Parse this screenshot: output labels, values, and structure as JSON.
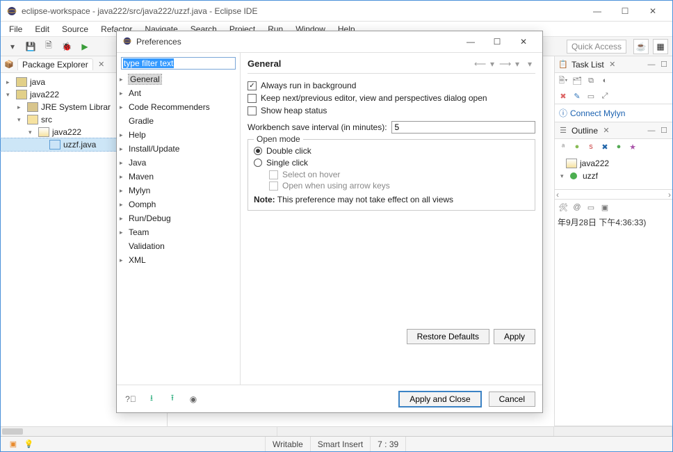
{
  "window": {
    "title": "eclipse-workspace - java222/src/java222/uzzf.java - Eclipse IDE"
  },
  "menu": [
    "File",
    "Edit",
    "Source",
    "Refactor",
    "Navigate",
    "Search",
    "Project",
    "Run",
    "Window",
    "Help"
  ],
  "quick_access": "Quick Access",
  "package_explorer": {
    "title": "Package Explorer",
    "items": {
      "java": "java",
      "java222": "java222",
      "jre": "JRE System Librar",
      "src": "src",
      "pkg": "java222",
      "file": "uzzf.java"
    }
  },
  "tasklist": {
    "title": "Task List"
  },
  "connect_mylyn": "Connect Mylyn",
  "outline": {
    "title": "Outline",
    "pkg": "java222",
    "cls": "uzzf"
  },
  "timestamp_fragment": "年9月28日 下午4:36:33)",
  "status": {
    "writable": "Writable",
    "insert": "Smart Insert",
    "pos": "7 : 39"
  },
  "prefs": {
    "title": "Preferences",
    "filter": "type filter text",
    "tree": [
      "General",
      "Ant",
      "Code Recommenders",
      "Gradle",
      "Help",
      "Install/Update",
      "Java",
      "Maven",
      "Mylyn",
      "Oomph",
      "Run/Debug",
      "Team",
      "Validation",
      "XML"
    ],
    "heading": "General",
    "chk_bg": "Always run in background",
    "chk_keep": "Keep next/previous editor, view and perspectives dialog open",
    "chk_heap": "Show heap status",
    "interval_label": "Workbench save interval (in minutes):",
    "interval_value": "5",
    "open_mode": "Open mode",
    "radio_double": "Double click",
    "radio_single": "Single click",
    "sub_hover": "Select on hover",
    "sub_arrow": "Open when using arrow keys",
    "note_label": "Note:",
    "note_text": "This preference may not take effect on all views",
    "restore": "Restore Defaults",
    "apply": "Apply",
    "apply_close": "Apply and Close",
    "cancel": "Cancel"
  }
}
